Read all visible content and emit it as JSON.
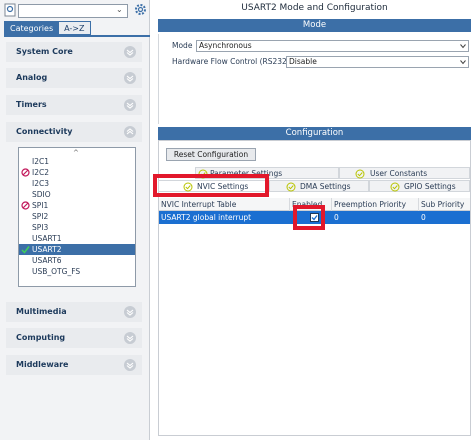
{
  "left_panel": {
    "search": {
      "value": "",
      "placeholder": ""
    },
    "tabs": {
      "categories": "Categories",
      "atoz": "A->Z"
    },
    "categories": [
      {
        "label": "System Core",
        "state": "collapsed"
      },
      {
        "label": "Analog",
        "state": "collapsed"
      },
      {
        "label": "Timers",
        "state": "collapsed"
      },
      {
        "label": "Connectivity",
        "state": "expanded"
      },
      {
        "label": "Multimedia",
        "state": "collapsed"
      },
      {
        "label": "Computing",
        "state": "collapsed"
      },
      {
        "label": "Middleware",
        "state": "collapsed"
      }
    ],
    "connectivity_items": [
      {
        "label": "I2C1",
        "status": "none"
      },
      {
        "label": "I2C2",
        "status": "conflict"
      },
      {
        "label": "I2C3",
        "status": "none"
      },
      {
        "label": "SDIO",
        "status": "none"
      },
      {
        "label": "SPI1",
        "status": "conflict"
      },
      {
        "label": "SPI2",
        "status": "none"
      },
      {
        "label": "SPI3",
        "status": "none"
      },
      {
        "label": "USART1",
        "status": "none"
      },
      {
        "label": "USART2",
        "status": "enabled",
        "selected": true
      },
      {
        "label": "USART6",
        "status": "none"
      },
      {
        "label": "USB_OTG_FS",
        "status": "none"
      }
    ]
  },
  "right_panel": {
    "title": "USART2 Mode and Configuration",
    "mode_section": "Mode",
    "mode": {
      "label": "Mode",
      "value": "Asynchronous"
    },
    "flow_control": {
      "label": "Hardware Flow Control (RS232)",
      "value": "Disable"
    },
    "config_section": "Configuration",
    "reset_button": "Reset Configuration",
    "config_tabs": {
      "parameter": "Parameter Settings",
      "user_constants": "User Constants",
      "nvic": "NVIC Settings",
      "dma": "DMA Settings",
      "gpio": "GPIO Settings"
    },
    "nvic_table": {
      "columns": [
        "NVIC Interrupt Table",
        "Enabled",
        "Preemption Priority",
        "Sub Priority"
      ],
      "rows": [
        {
          "name": "USART2 global interrupt",
          "enabled": true,
          "preemption": "0",
          "sub": "0"
        }
      ]
    }
  },
  "colors": {
    "accent": "#3c6fa7",
    "selected_row": "#1b6fd1",
    "highlight": "#e2182b",
    "ok": "#b8c400",
    "conflict": "#c2185b",
    "enabled": "#2e9e48"
  }
}
